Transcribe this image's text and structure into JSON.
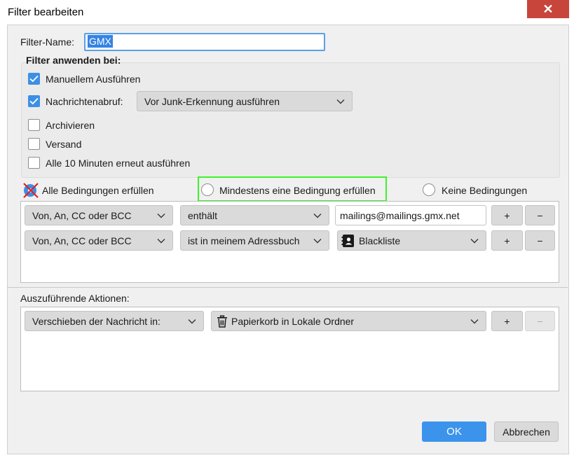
{
  "window": {
    "title": "Filter bearbeiten",
    "close_glyph": "✕"
  },
  "filter_name": {
    "label": "Filter-Name:",
    "value": "GMX"
  },
  "apply_when": {
    "heading": "Filter anwenden bei:",
    "options": [
      {
        "label": "Manuellem Ausführen",
        "checked": true
      },
      {
        "label": "Nachrichtenabruf:",
        "checked": true
      },
      {
        "label": "Archivieren",
        "checked": false
      },
      {
        "label": "Versand",
        "checked": false
      },
      {
        "label": "Alle 10 Minuten erneut ausführen",
        "checked": false
      }
    ],
    "fetch_timing": "Vor Junk-Erkennung ausführen"
  },
  "match_mode": {
    "options": [
      {
        "label": "Alle Bedingungen erfüllen",
        "selected": true
      },
      {
        "label": "Mindestens eine Bedingung erfüllen",
        "selected": false
      },
      {
        "label": "Keine Bedingungen",
        "selected": false
      }
    ]
  },
  "conditions": [
    {
      "field": "Von, An, CC oder BCC",
      "operator": "enthält",
      "value": "mailings@mailings.gmx.net",
      "add": "+",
      "remove": "−"
    },
    {
      "field": "Von, An, CC oder BCC",
      "operator": "ist in meinem Adressbuch",
      "value": "Blackliste",
      "value_icon": "address-book-icon",
      "add": "+",
      "remove": "−"
    }
  ],
  "actions": {
    "heading": "Auszuführende Aktionen:",
    "items": [
      {
        "action": "Verschieben der Nachricht in:",
        "target": "Papierkorb in Lokale Ordner",
        "target_icon": "trash-icon",
        "add": "+",
        "remove": "−"
      }
    ]
  },
  "footer": {
    "ok": "OK",
    "cancel": "Abbrechen"
  },
  "colors": {
    "accent": "#3c8fe6",
    "highlight_box": "#3ef22b",
    "close": "#c7453b"
  }
}
